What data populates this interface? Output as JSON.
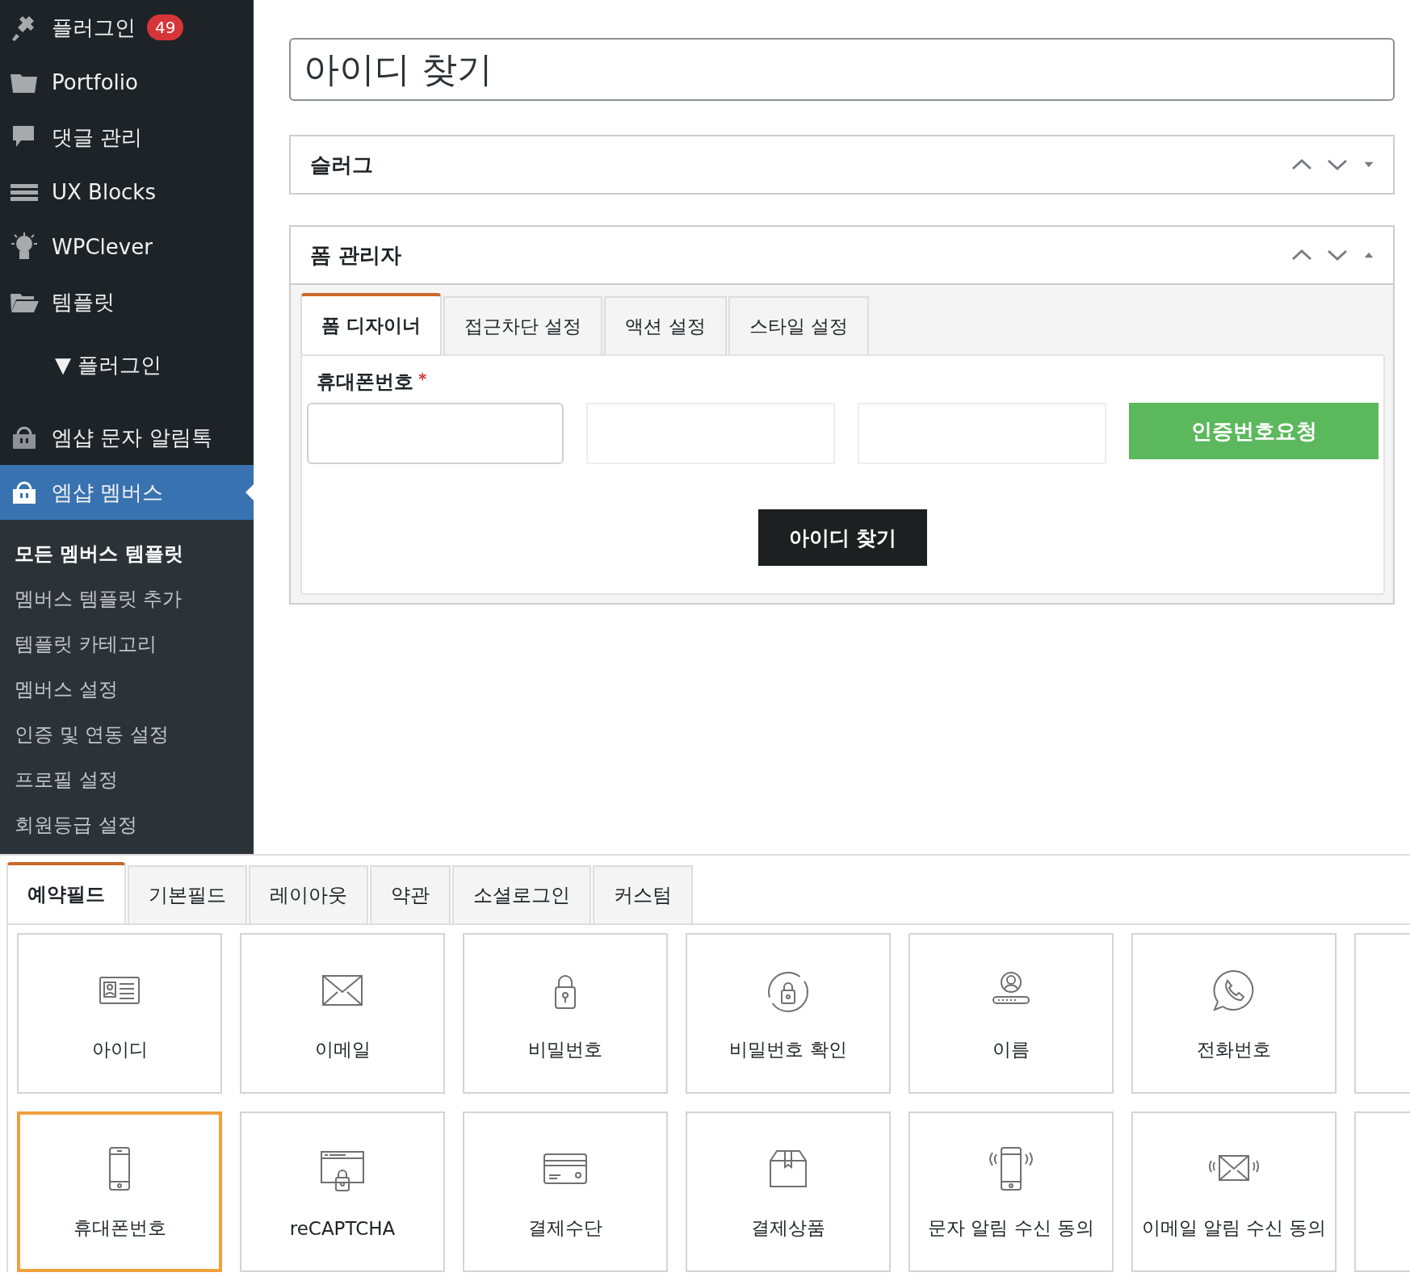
{
  "sidebar": {
    "menu": [
      {
        "label": "플러그인",
        "badge": "49",
        "kind": "link",
        "selected": false
      },
      {
        "label": "Portfolio",
        "kind": "link",
        "selected": false
      },
      {
        "label": "댓글 관리",
        "kind": "link",
        "selected": false
      },
      {
        "label": "UX Blocks",
        "kind": "link",
        "selected": false
      },
      {
        "label": "WPClever",
        "kind": "link",
        "selected": false
      },
      {
        "label": "템플릿",
        "kind": "link",
        "selected": false
      },
      {
        "label": "▼ 플러그인",
        "kind": "section",
        "selected": false
      },
      {
        "label": "엠샵 문자 알림톡",
        "kind": "link",
        "selected": false
      },
      {
        "label": "엠샵 멤버스",
        "kind": "link",
        "selected": true
      }
    ],
    "submenu": [
      {
        "label": "모든 멤버스 템플릿",
        "selected": true
      },
      {
        "label": "멤버스 템플릿 추가",
        "selected": false
      },
      {
        "label": "템플릿 카테고리",
        "selected": false
      },
      {
        "label": "멤버스 설정",
        "selected": false
      },
      {
        "label": "인증 및 연동 설정",
        "selected": false
      },
      {
        "label": "프로필 설정",
        "selected": false
      },
      {
        "label": "회원등급 설정",
        "selected": false
      }
    ]
  },
  "title_field": {
    "value": "아이디 찾기"
  },
  "metaboxes": [
    {
      "title": "슬러그",
      "expanded": false
    },
    {
      "title": "폼 관리자",
      "expanded": true,
      "tabs": [
        {
          "label": "폼 디자이너",
          "selected": true
        },
        {
          "label": "접근차단 설정",
          "selected": false
        },
        {
          "label": "액션 설정",
          "selected": false
        },
        {
          "label": "스타일 설정",
          "selected": false
        }
      ],
      "form": {
        "label": "휴대폰번호",
        "required": true,
        "required_mark": "*",
        "inputs": [
          {
            "focused": true
          },
          {
            "focused": false
          },
          {
            "focused": false
          }
        ],
        "request_button": "인증번호요청",
        "submit_button": "아이디 찾기"
      }
    }
  ],
  "field_palette": {
    "tabs": [
      {
        "label": "예약필드",
        "selected": true
      },
      {
        "label": "기본필드",
        "selected": false
      },
      {
        "label": "레이아웃",
        "selected": false
      },
      {
        "label": "약관",
        "selected": false
      },
      {
        "label": "소셜로그인",
        "selected": false
      },
      {
        "label": "커스텀",
        "selected": false
      }
    ],
    "fields": [
      {
        "label": "아이디",
        "selected": false
      },
      {
        "label": "이메일",
        "selected": false
      },
      {
        "label": "비밀번호",
        "selected": false
      },
      {
        "label": "비밀번호 확인",
        "selected": false
      },
      {
        "label": "이름",
        "selected": false
      },
      {
        "label": "전화번호",
        "selected": false
      },
      {
        "selected": false
      },
      {
        "label": "휴대폰번호",
        "selected": true
      },
      {
        "label": "reCAPTCHA",
        "selected": false
      },
      {
        "label": "결제수단",
        "selected": false
      },
      {
        "label": "결제상품",
        "selected": false
      },
      {
        "label": "문자 알림 수신 동의",
        "selected": false
      },
      {
        "label": "이메일 알림 수신 동의",
        "selected": false
      },
      {
        "selected": false
      }
    ]
  }
}
